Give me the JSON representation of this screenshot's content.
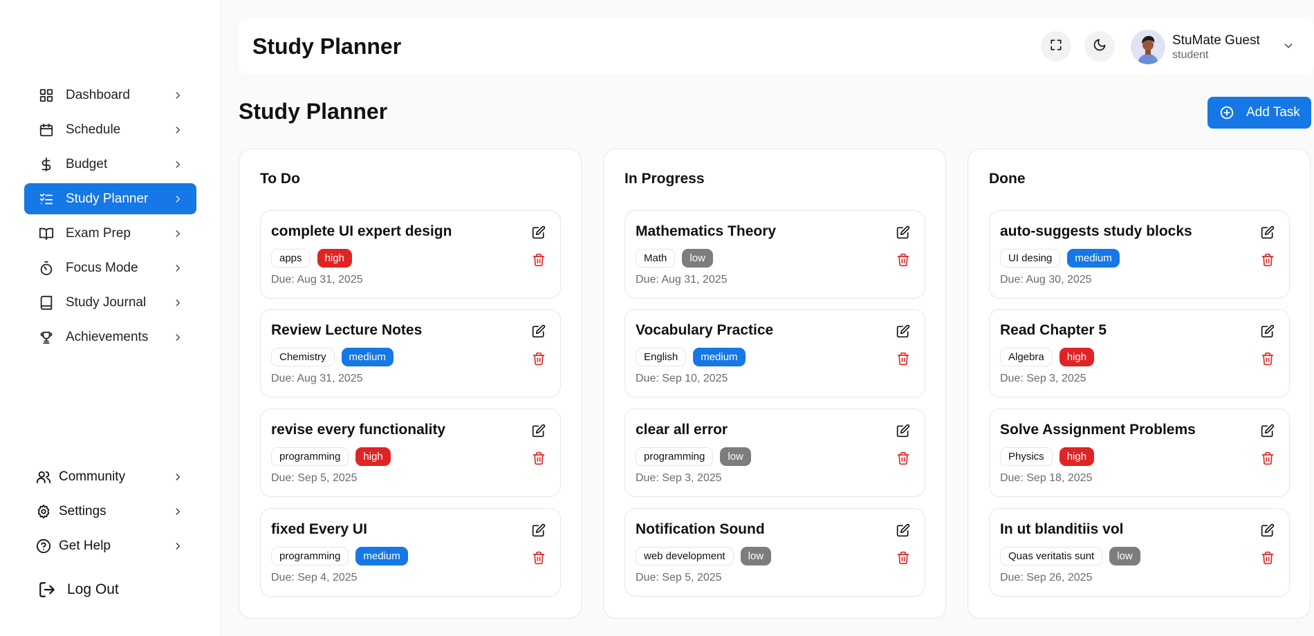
{
  "sidebar": {
    "nav": [
      {
        "label": "Dashboard",
        "icon": "grid-icon"
      },
      {
        "label": "Schedule",
        "icon": "calendar-icon"
      },
      {
        "label": "Budget",
        "icon": "dollar-icon"
      },
      {
        "label": "Study Planner",
        "icon": "checklist-icon",
        "active": true
      },
      {
        "label": "Exam Prep",
        "icon": "book-open-icon"
      },
      {
        "label": "Focus Mode",
        "icon": "timer-icon"
      },
      {
        "label": "Study Journal",
        "icon": "book-icon"
      },
      {
        "label": "Achievements",
        "icon": "trophy-icon"
      }
    ],
    "bottom": [
      {
        "label": "Community",
        "icon": "users-icon"
      },
      {
        "label": "Settings",
        "icon": "gear-icon"
      },
      {
        "label": "Get Help",
        "icon": "help-icon"
      }
    ],
    "logout_label": "Log Out"
  },
  "header": {
    "title": "Study Planner",
    "user_name": "StuMate Guest",
    "user_role": "student"
  },
  "main": {
    "title": "Study Planner",
    "add_task_label": "Add Task",
    "columns": [
      {
        "title": "To Do",
        "cards": [
          {
            "title": "complete UI expert design",
            "tag": "apps",
            "priority": "high",
            "due": "Due: Aug 31, 2025"
          },
          {
            "title": "Review Lecture Notes",
            "tag": "Chemistry",
            "priority": "medium",
            "due": "Due: Aug 31, 2025"
          },
          {
            "title": "revise every functionality",
            "tag": "programming",
            "priority": "high",
            "due": "Due: Sep 5, 2025"
          },
          {
            "title": "fixed Every UI",
            "tag": "programming",
            "priority": "medium",
            "due": "Due: Sep 4, 2025"
          }
        ]
      },
      {
        "title": "In Progress",
        "cards": [
          {
            "title": "Mathematics Theory",
            "tag": "Math",
            "priority": "low",
            "due": "Due: Aug 31, 2025"
          },
          {
            "title": "Vocabulary Practice",
            "tag": "English",
            "priority": "medium",
            "due": "Due: Sep 10, 2025"
          },
          {
            "title": "clear all error",
            "tag": "programming",
            "priority": "low",
            "due": "Due: Sep 3, 2025"
          },
          {
            "title": "Notification Sound",
            "tag": "web development",
            "priority": "low",
            "due": "Due: Sep 5, 2025"
          }
        ]
      },
      {
        "title": "Done",
        "cards": [
          {
            "title": "auto-suggests study blocks",
            "tag": "UI desing",
            "priority": "medium",
            "due": "Due: Aug 30, 2025"
          },
          {
            "title": "Read Chapter 5",
            "tag": "Algebra",
            "priority": "high",
            "due": "Due: Sep 3, 2025"
          },
          {
            "title": "Solve Assignment Problems",
            "tag": "Physics",
            "priority": "high",
            "due": "Due: Sep 18, 2025"
          },
          {
            "title": "In ut blanditiis vol",
            "tag": "Quas veritatis sunt",
            "priority": "low",
            "due": "Due: Sep 26, 2025"
          }
        ]
      }
    ]
  },
  "colors": {
    "accent": "#1677e6",
    "high": "#e02424",
    "medium": "#1677e6",
    "low": "#7d7d7d"
  }
}
